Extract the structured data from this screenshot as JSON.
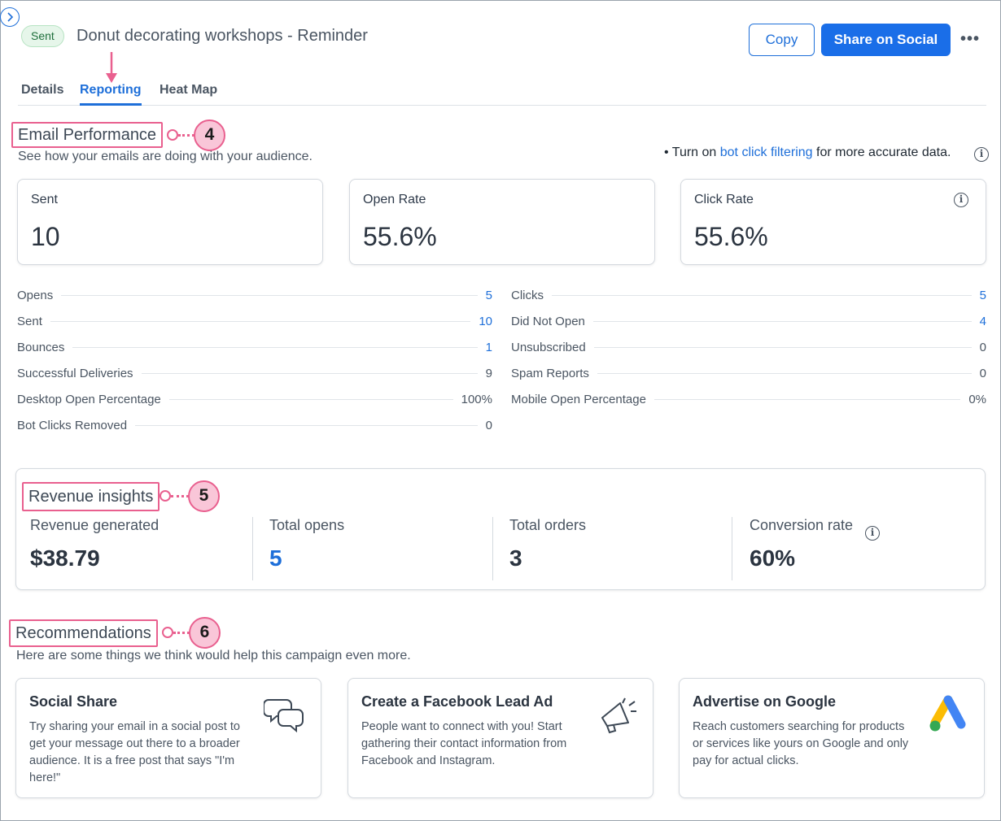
{
  "header": {
    "status_badge": "Sent",
    "title": "Donut decorating workshops - Reminder",
    "copy_label": "Copy",
    "share_label": "Share on Social",
    "more_label": "•••"
  },
  "tabs": [
    {
      "label": "Details"
    },
    {
      "label": "Reporting",
      "active": true
    },
    {
      "label": "Heat Map"
    }
  ],
  "callouts": {
    "email_performance": "4",
    "revenue_insights": "5",
    "recommendations": "6"
  },
  "email_performance": {
    "title": "Email Performance",
    "subtitle": "See how your emails are doing with your audience.",
    "bot_note_prefix": "• Turn on ",
    "bot_note_link": "bot click filtering",
    "bot_note_suffix": " for more accurate data.",
    "cards": [
      {
        "label": "Sent",
        "value": "10"
      },
      {
        "label": "Open Rate",
        "value": "55.6%"
      },
      {
        "label": "Click Rate",
        "value": "55.6%"
      }
    ],
    "metrics_left": [
      {
        "label": "Opens",
        "value": "5",
        "link": true
      },
      {
        "label": "Sent",
        "value": "10",
        "link": true
      },
      {
        "label": "Bounces",
        "value": "1",
        "link": true
      },
      {
        "label": "Successful Deliveries",
        "value": "9",
        "link": false
      },
      {
        "label": "Desktop Open Percentage",
        "value": "100%",
        "link": false
      },
      {
        "label": "Bot Clicks Removed",
        "value": "0",
        "link": false
      }
    ],
    "metrics_right": [
      {
        "label": "Clicks",
        "value": "5",
        "link": true
      },
      {
        "label": "Did Not Open",
        "value": "4",
        "link": true
      },
      {
        "label": "Unsubscribed",
        "value": "0",
        "link": false
      },
      {
        "label": "Spam Reports",
        "value": "0",
        "link": false
      },
      {
        "label": "Mobile Open Percentage",
        "value": "0%",
        "link": false
      }
    ]
  },
  "revenue_insights": {
    "title": "Revenue insights",
    "columns": [
      {
        "label": "Revenue generated",
        "value": "$38.79"
      },
      {
        "label": "Total opens",
        "value": "5"
      },
      {
        "label": "Total orders",
        "value": "3"
      },
      {
        "label": "Conversion rate",
        "value": "60%"
      }
    ]
  },
  "recommendations": {
    "title": "Recommendations",
    "subtitle": "Here are some things we think would help this campaign even more.",
    "cards": [
      {
        "title": "Social Share",
        "body": "Try sharing your email in a social post to get your message out there to a broader audience. It is a free post that says \"I'm here!\"",
        "icon": "chat-bubbles-icon"
      },
      {
        "title": "Create a Facebook Lead Ad",
        "body": "People want to connect with you! Start gathering their contact information from Facebook and Instagram.",
        "icon": "megaphone-icon"
      },
      {
        "title": "Advertise on Google",
        "body": "Reach customers searching for products or services like yours on Google and only pay for actual clicks.",
        "icon": "google-ads-icon"
      }
    ]
  },
  "colors": {
    "accent": "#1e6fd9",
    "callout": "#e9608f",
    "callout_fill": "#f9c6d8",
    "sent_badge_bg": "#e6f6ea"
  }
}
